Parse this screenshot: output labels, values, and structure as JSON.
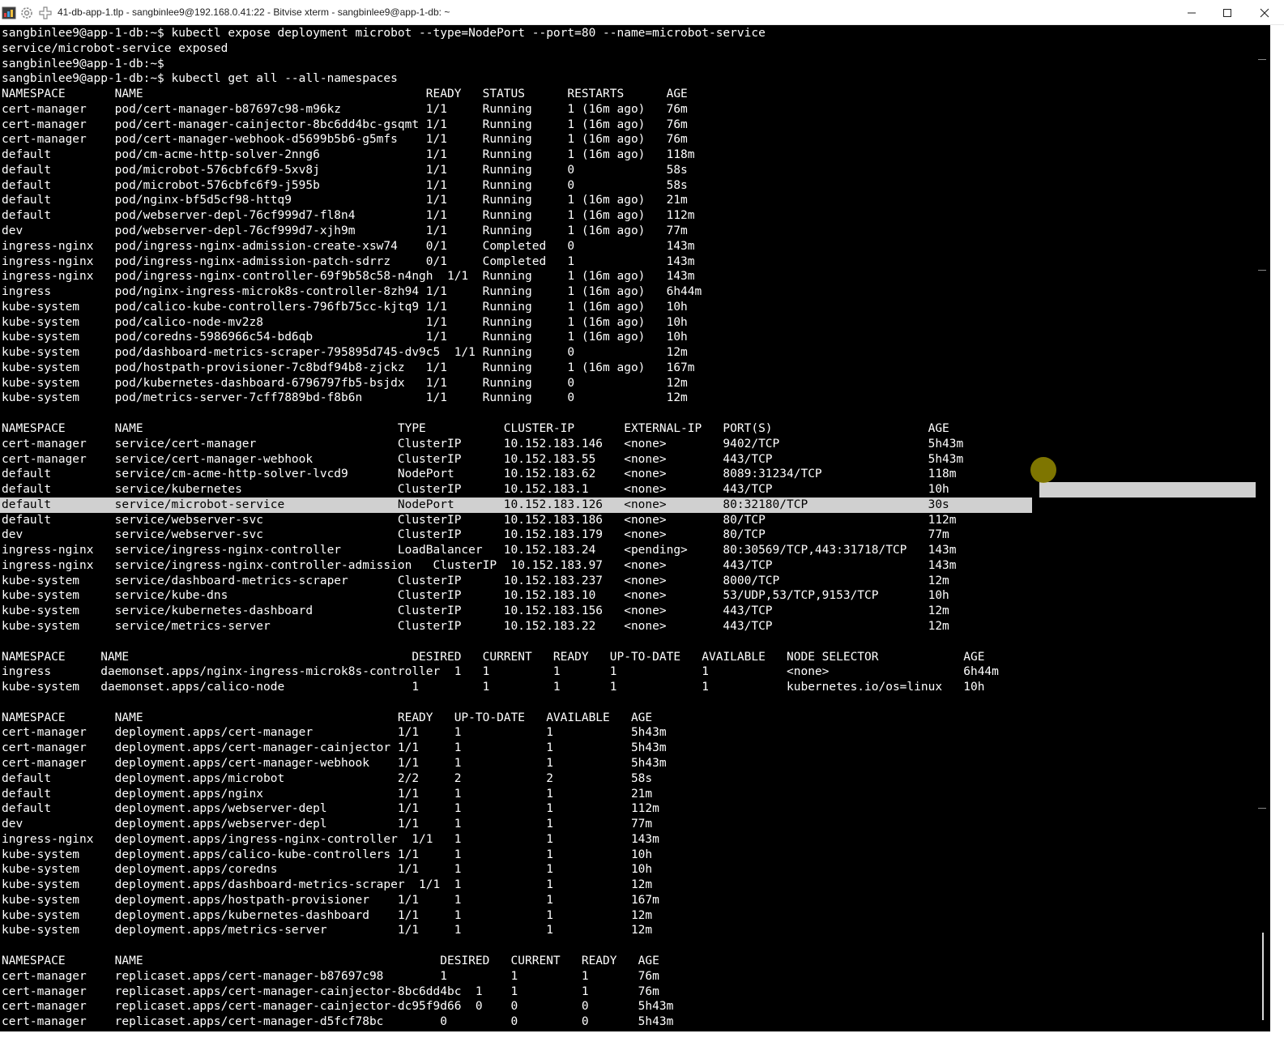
{
  "window": {
    "title": "41-db-app-1.tlp - sangbinlee9@192.168.0.41:22 - Bitvise xterm - sangbinlee9@app-1-db: ~",
    "icons": [
      "app-icon",
      "gear-icon",
      "plus-icon"
    ],
    "controls": [
      "minimize-icon",
      "maximize-icon",
      "close-icon"
    ]
  },
  "terminal": {
    "background": "#000000",
    "foreground": "#ffffff",
    "highlight_bg": "#d0d0d0",
    "lines": [
      "sangbinlee9@app-1-db:~$ kubectl expose deployment microbot --type=NodePort --port=80 --name=microbot-service",
      "service/microbot-service exposed",
      "sangbinlee9@app-1-db:~$",
      "sangbinlee9@app-1-db:~$ kubectl get all --all-namespaces",
      "NAMESPACE       NAME                                        READY   STATUS      RESTARTS      AGE",
      "cert-manager    pod/cert-manager-b87697c98-m96kz            1/1     Running     1 (16m ago)   76m",
      "cert-manager    pod/cert-manager-cainjector-8bc6dd4bc-gsqmt 1/1     Running     1 (16m ago)   76m",
      "cert-manager    pod/cert-manager-webhook-d5699b5b6-g5mfs    1/1     Running     1 (16m ago)   76m",
      "default         pod/cm-acme-http-solver-2nng6               1/1     Running     1 (16m ago)   118m",
      "default         pod/microbot-576cbfc6f9-5xv8j               1/1     Running     0             58s",
      "default         pod/microbot-576cbfc6f9-j595b               1/1     Running     0             58s",
      "default         pod/nginx-bf5d5cf98-httq9                   1/1     Running     1 (16m ago)   21m",
      "default         pod/webserver-depl-76cf999d7-fl8n4          1/1     Running     1 (16m ago)   112m",
      "dev             pod/webserver-depl-76cf999d7-xjh9m          1/1     Running     1 (16m ago)   77m",
      "ingress-nginx   pod/ingress-nginx-admission-create-xsw74    0/1     Completed   0             143m",
      "ingress-nginx   pod/ingress-nginx-admission-patch-sdrrz     0/1     Completed   1             143m",
      "ingress-nginx   pod/ingress-nginx-controller-69f9b58c58-n4ngh  1/1  Running     1 (16m ago)   143m",
      "ingress         pod/nginx-ingress-microk8s-controller-8zh94 1/1     Running     1 (16m ago)   6h44m",
      "kube-system     pod/calico-kube-controllers-796fb75cc-kjtq9 1/1     Running     1 (16m ago)   10h",
      "kube-system     pod/calico-node-mv2z8                       1/1     Running     1 (16m ago)   10h",
      "kube-system     pod/coredns-5986966c54-bd6qb                1/1     Running     1 (16m ago)   10h",
      "kube-system     pod/dashboard-metrics-scraper-795895d745-dv9c5  1/1 Running     0             12m",
      "kube-system     pod/hostpath-provisioner-7c8bdf94b8-zjckz   1/1     Running     1 (16m ago)   167m",
      "kube-system     pod/kubernetes-dashboard-6796797fb5-bsjdx   1/1     Running     0             12m",
      "kube-system     pod/metrics-server-7cff7889bd-f8b6n         1/1     Running     0             12m",
      "",
      "NAMESPACE       NAME                                    TYPE           CLUSTER-IP       EXTERNAL-IP   PORT(S)                      AGE",
      "cert-manager    service/cert-manager                    ClusterIP      10.152.183.146   <none>        9402/TCP                     5h43m",
      "cert-manager    service/cert-manager-webhook            ClusterIP      10.152.183.55    <none>        443/TCP                      5h43m",
      "default         service/cm-acme-http-solver-lvcd9       NodePort       10.152.183.62    <none>        8089:31234/TCP               118m",
      "default         service/kubernetes                      ClusterIP      10.152.183.1     <none>        443/TCP                      10h",
      "default         service/microbot-service                NodePort       10.152.183.126   <none>        80:32180/TCP                 30s",
      "default         service/webserver-svc                   ClusterIP      10.152.183.186   <none>        80/TCP                       112m",
      "dev             service/webserver-svc                   ClusterIP      10.152.183.179   <none>        80/TCP                       77m",
      "ingress-nginx   service/ingress-nginx-controller        LoadBalancer   10.152.183.24    <pending>     80:30569/TCP,443:31718/TCP   143m",
      "ingress-nginx   service/ingress-nginx-controller-admission   ClusterIP  10.152.183.97   <none>        443/TCP                      143m",
      "kube-system     service/dashboard-metrics-scraper       ClusterIP      10.152.183.237   <none>        8000/TCP                     12m",
      "kube-system     service/kube-dns                        ClusterIP      10.152.183.10    <none>        53/UDP,53/TCP,9153/TCP       10h",
      "kube-system     service/kubernetes-dashboard            ClusterIP      10.152.183.156   <none>        443/TCP                      12m",
      "kube-system     service/metrics-server                  ClusterIP      10.152.183.22    <none>        443/TCP                      12m",
      "",
      "NAMESPACE     NAME                                        DESIRED   CURRENT   READY   UP-TO-DATE   AVAILABLE   NODE SELECTOR            AGE",
      "ingress       daemonset.apps/nginx-ingress-microk8s-controller  1   1         1       1            1           <none>                   6h44m",
      "kube-system   daemonset.apps/calico-node                  1         1         1       1            1           kubernetes.io/os=linux   10h",
      "",
      "NAMESPACE       NAME                                    READY   UP-TO-DATE   AVAILABLE   AGE",
      "cert-manager    deployment.apps/cert-manager            1/1     1            1           5h43m",
      "cert-manager    deployment.apps/cert-manager-cainjector 1/1     1            1           5h43m",
      "cert-manager    deployment.apps/cert-manager-webhook    1/1     1            1           5h43m",
      "default         deployment.apps/microbot                2/2     2            2           58s",
      "default         deployment.apps/nginx                   1/1     1            1           21m",
      "default         deployment.apps/webserver-depl          1/1     1            1           112m",
      "dev             deployment.apps/webserver-depl          1/1     1            1           77m",
      "ingress-nginx   deployment.apps/ingress-nginx-controller  1/1   1            1           143m",
      "kube-system     deployment.apps/calico-kube-controllers 1/1     1            1           10h",
      "kube-system     deployment.apps/coredns                 1/1     1            1           10h",
      "kube-system     deployment.apps/dashboard-metrics-scraper  1/1  1            1           12m",
      "kube-system     deployment.apps/hostpath-provisioner    1/1     1            1           167m",
      "kube-system     deployment.apps/kubernetes-dashboard    1/1     1            1           12m",
      "kube-system     deployment.apps/metrics-server          1/1     1            1           12m",
      "",
      "NAMESPACE       NAME                                          DESIRED   CURRENT   READY   AGE",
      "cert-manager    replicaset.apps/cert-manager-b87697c98        1         1         1       76m",
      "cert-manager    replicaset.apps/cert-manager-cainjector-8bc6dd4bc  1    1         1       76m",
      "cert-manager    replicaset.apps/cert-manager-cainjector-dc95f9d66  0    0         0       5h43m",
      "cert-manager    replicaset.apps/cert-manager-d5fcf78bc        0         0         0       5h43m"
    ]
  }
}
